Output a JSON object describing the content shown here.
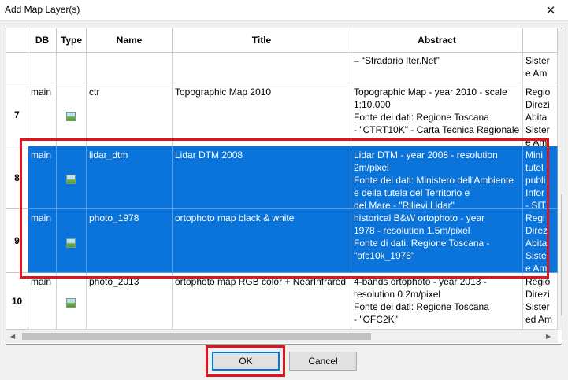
{
  "window": {
    "title": "Add Map Layer(s)",
    "close_glyph": "✕"
  },
  "columns": {
    "db": "DB",
    "type": "Type",
    "name": "Name",
    "title": "Title",
    "abstract": "Abstract"
  },
  "rows": [
    {
      "num": "",
      "db": "",
      "name": "",
      "title": "",
      "abstract": [
        "– “Stradario Iter.Net”"
      ],
      "extra": [
        "Sister",
        "e Am"
      ]
    },
    {
      "num": "7",
      "db": "main",
      "name": "ctr",
      "title": "Topographic Map 2010",
      "abstract": [
        "Topographic Map - year 2010 - scale",
        "1:10.000",
        "Fonte dei dati: Regione Toscana",
        "- \"CTRT10K\" - Carta Tecnica Regionale"
      ],
      "extra": [
        "Regio",
        "Direzi",
        "Abita",
        "Sister",
        "e Am"
      ]
    },
    {
      "num": "8",
      "db": "main",
      "name": "lidar_dtm",
      "title": "Lidar DTM 2008",
      "abstract": [
        "Lidar DTM - year 2008 - resolution",
        "2m/pixel",
        "Fonte dei dati: Ministero dell'Ambiente",
        "e della tutela del Territorio e",
        "del Mare - \"Rilievi Lidar\""
      ],
      "extra": [
        "Mini",
        "tutel",
        "publi",
        "Infor",
        "- SIT"
      ]
    },
    {
      "num": "9",
      "db": "main",
      "name": "photo_1978",
      "title": "ortophoto map black & white",
      "abstract": [
        "historical B&W ortophoto - year",
        "1978 - resolution 1.5m/pixel",
        "Fonte di dati: Regione Toscana -",
        "\"ofc10k_1978\""
      ],
      "extra": [
        "Regi",
        "Direz",
        "Abita",
        "Siste",
        "e Am"
      ]
    },
    {
      "num": "10",
      "db": "main",
      "name": "photo_2013",
      "title": "ortophoto map RGB color + NearInfrared",
      "abstract": [
        "4-bands ortophoto - year 2013 -",
        "resolution 0.2m/pixel",
        "Fonte dei dati: Regione Toscana",
        "- \"OFC2K\""
      ],
      "extra": [
        "Regio",
        "Direzi",
        "Sister",
        "ed Am"
      ]
    }
  ],
  "buttons": {
    "ok": "OK",
    "cancel": "Cancel"
  },
  "colors": {
    "selection": "#0a74da",
    "highlight": "#e0141e"
  }
}
